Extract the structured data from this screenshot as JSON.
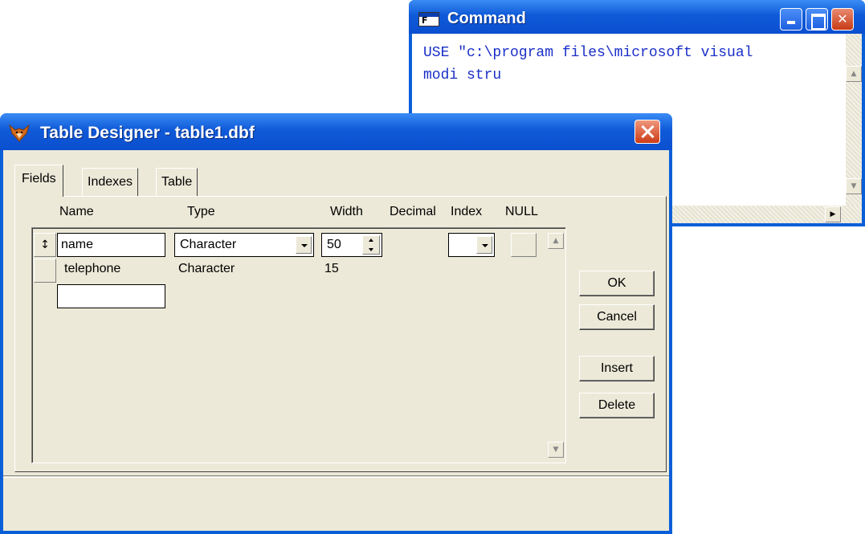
{
  "command_window": {
    "title": "Command",
    "lines": [
      "USE \"c:\\program files\\microsoft visual",
      "modi stru"
    ]
  },
  "table_designer": {
    "title": "Table Designer - table1.dbf",
    "tabs": [
      {
        "label": "Fields",
        "active": true
      },
      {
        "label": "Indexes",
        "active": false
      },
      {
        "label": "Table",
        "active": false
      }
    ],
    "columns": [
      "Name",
      "Type",
      "Width",
      "Decimal",
      "Index",
      "NULL"
    ],
    "rows": [
      {
        "selector": "↕",
        "name": "name",
        "type": "Character",
        "width": "50"
      },
      {
        "selector": "",
        "name": "telephone",
        "type": "Character",
        "width": "15"
      },
      {
        "selector": "",
        "name": "",
        "type": "",
        "width": ""
      }
    ],
    "buttons": {
      "ok": "OK",
      "cancel": "Cancel",
      "insert": "Insert",
      "delete": "Delete"
    }
  },
  "colors": {
    "titlebar": "#0a5fd8",
    "dialog_face": "#ece9d8",
    "close_button": "#cc3b16",
    "command_text": "#1a2fc8"
  }
}
